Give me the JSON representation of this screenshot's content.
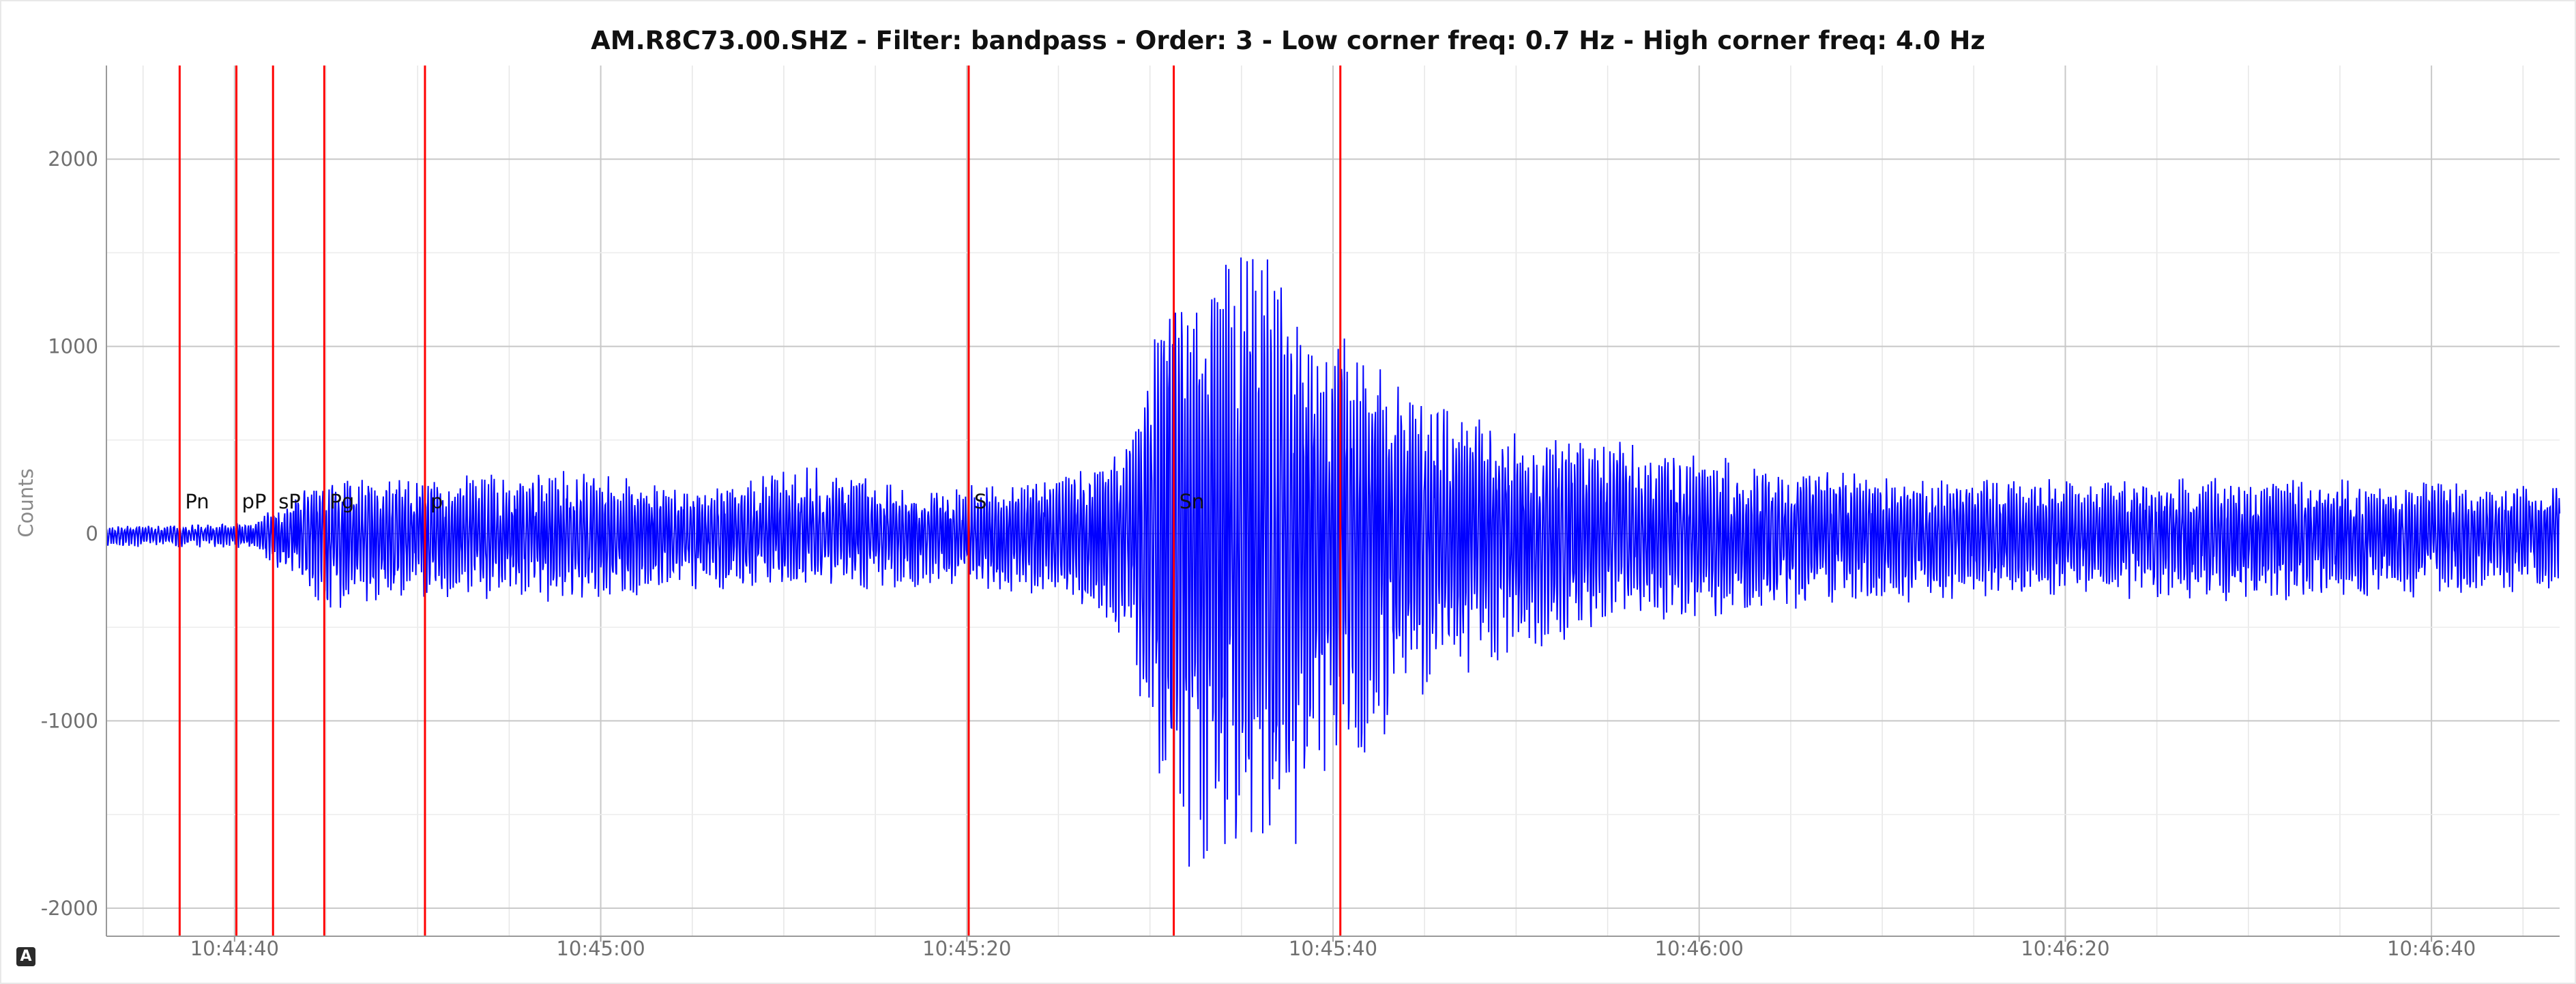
{
  "chart_data": {
    "type": "line",
    "title": "AM.R8C73.00.SHZ - Filter: bandpass - Order: 3 - Low corner freq: 0.7 Hz - High corner freq: 4.0 Hz",
    "xlabel": "",
    "ylabel": "Counts",
    "x_start": "10:44:33",
    "x_end": "10:46:47",
    "ylim": [
      -2150,
      2500
    ],
    "y_ticks": [
      2000,
      1000,
      0,
      -1000,
      -2000
    ],
    "y_tick_labels": [
      "2000",
      "1000",
      "0",
      "-1000",
      "-2000"
    ],
    "x_ticks": [
      "10:44:40",
      "10:45:00",
      "10:45:20",
      "10:45:40",
      "10:46:00",
      "10:46:20",
      "10:46:40"
    ],
    "grid": true,
    "series": [
      {
        "color": "#0000ff",
        "envelope": [
          {
            "t": "10:44:33",
            "max": 40,
            "min": -70
          },
          {
            "t": "10:44:41",
            "max": 60,
            "min": -80
          },
          {
            "t": "10:44:45",
            "max": 330,
            "min": -420
          },
          {
            "t": "10:44:50",
            "max": 300,
            "min": -350
          },
          {
            "t": "10:44:58",
            "max": 340,
            "min": -370
          },
          {
            "t": "10:45:06",
            "max": 260,
            "min": -300
          },
          {
            "t": "10:45:12",
            "max": 380,
            "min": -300
          },
          {
            "t": "10:45:18",
            "max": 250,
            "min": -300
          },
          {
            "t": "10:45:24",
            "max": 300,
            "min": -330
          },
          {
            "t": "10:45:27",
            "max": 350,
            "min": -450
          },
          {
            "t": "10:45:29",
            "max": 560,
            "min": -720
          },
          {
            "t": "10:45:31",
            "max": 1340,
            "min": -1690
          },
          {
            "t": "10:45:34",
            "max": 1460,
            "min": -1960
          },
          {
            "t": "10:45:36",
            "max": 1660,
            "min": -1820
          },
          {
            "t": "10:45:38",
            "max": 1190,
            "min": -1680
          },
          {
            "t": "10:45:40",
            "max": 1050,
            "min": -1260
          },
          {
            "t": "10:45:42",
            "max": 1050,
            "min": -1250
          },
          {
            "t": "10:45:44",
            "max": 800,
            "min": -900
          },
          {
            "t": "10:45:46",
            "max": 720,
            "min": -850
          },
          {
            "t": "10:45:50",
            "max": 560,
            "min": -650
          },
          {
            "t": "10:45:56",
            "max": 520,
            "min": -500
          },
          {
            "t": "10:46:04",
            "max": 360,
            "min": -420
          },
          {
            "t": "10:46:12",
            "max": 300,
            "min": -380
          },
          {
            "t": "10:46:20",
            "max": 300,
            "min": -350
          },
          {
            "t": "10:46:30",
            "max": 300,
            "min": -370
          },
          {
            "t": "10:46:40",
            "max": 290,
            "min": -340
          },
          {
            "t": "10:46:47",
            "max": 260,
            "min": -300
          }
        ]
      }
    ],
    "phases": [
      {
        "label": "Pn",
        "t": "10:44:37.0"
      },
      {
        "label": "pP",
        "t": "10:44:40.1"
      },
      {
        "label": "sP",
        "t": "10:44:42.1"
      },
      {
        "label": "Pg",
        "t": "10:44:44.9"
      },
      {
        "label": "p",
        "t": "10:44:50.4"
      },
      {
        "label": "S",
        "t": "10:45:20.1"
      },
      {
        "label": "Sn",
        "t": "10:45:31.3"
      },
      {
        "label": "",
        "t": "10:45:40.4"
      }
    ],
    "phase_color": "#ff0000"
  },
  "footer": {
    "badge_label": "A"
  }
}
